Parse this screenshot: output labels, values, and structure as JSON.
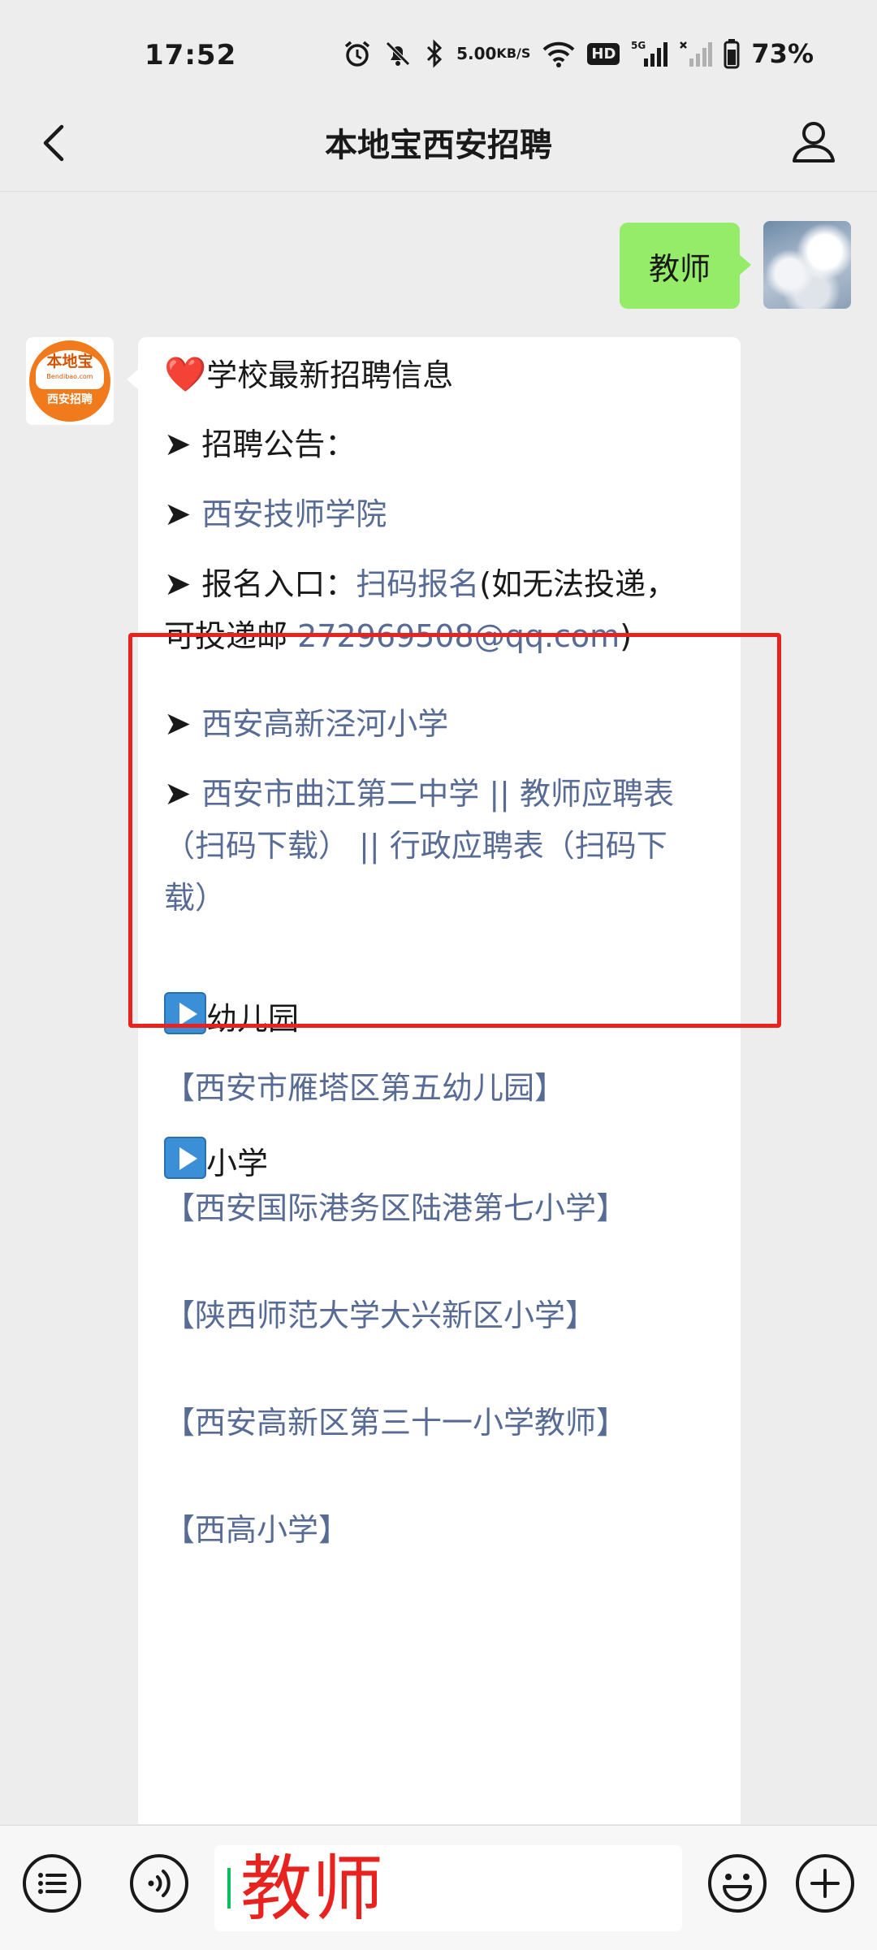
{
  "status_bar": {
    "time": "17:52",
    "net_speed_value": "5.00",
    "net_speed_unit": "KB/S",
    "hd_label": "HD",
    "signal_label": "5G",
    "battery": "73%"
  },
  "nav": {
    "title": "本地宝西安招聘",
    "back_icon": "chevron-left-icon",
    "profile_icon": "person-icon"
  },
  "messages": {
    "user_text": "教师",
    "bot_avatar_name": "本地宝",
    "bot_avatar_domain": "Bendibao.com",
    "bot_avatar_sub": "西安招聘",
    "header": "学校最新招聘信息",
    "section1_label": "招聘公告：",
    "item1": "西安技师学院",
    "item2_label": "报名入口：",
    "item2_link": "扫码报名",
    "item2_note_a": "(如无法投递，",
    "item2_note_b": "可投递邮",
    "item2_email": "272969508@qq.com",
    "item2_note_c": ")",
    "item3": "西安高新泾河小学",
    "item4_line1": "西安市曲江第二中学 || 教师应聘表",
    "item4_line2": "（扫码下载） || 行政应聘表（扫码下",
    "item4_line3": "载）",
    "section_kindergarten": "幼儿园",
    "kg1": "【西安市雁塔区第五幼儿园】",
    "section_primary": "小学",
    "ps1": "【西安国际港务区陆港第七小学】",
    "ps2": "【陕西师范大学大兴新区小学】",
    "ps3": "【西安高新区第三十一小学教师】",
    "ps4": "【西高小学】"
  },
  "input_bar": {
    "text": "教师",
    "icons": [
      "menu-icon",
      "voice-icon",
      "emoji-icon",
      "plus-icon"
    ]
  },
  "colors": {
    "link": "#576b95",
    "user_bubble": "#95ec69",
    "highlight": "#e8231f",
    "caret": "#07c160"
  }
}
